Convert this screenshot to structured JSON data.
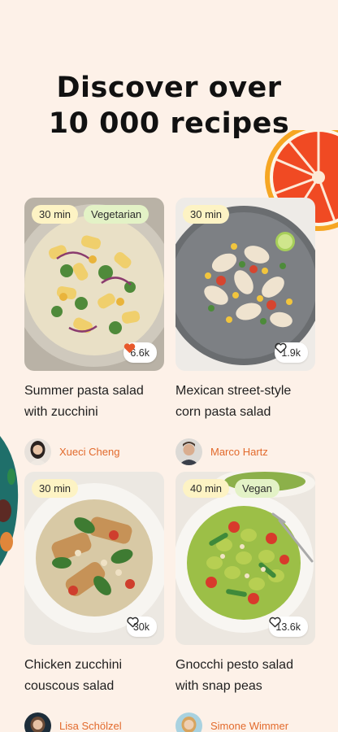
{
  "headline": {
    "line1": "Discover over",
    "line2": "10 000 recipes"
  },
  "cards": [
    {
      "time": "30 min",
      "diet": "Vegetarian",
      "likes": "6.6k",
      "liked": true,
      "title_line1": "Summer pasta salad",
      "title_line2": "with zucchini",
      "author": "Xueci Cheng"
    },
    {
      "time": "30 min",
      "diet": "",
      "likes": "1.9k",
      "liked": false,
      "title_line1": "Mexican street-style",
      "title_line2": "corn pasta salad",
      "author": "Marco Hartz"
    },
    {
      "time": "30 min",
      "diet": "",
      "likes": "30k",
      "liked": false,
      "title_line1": "Chicken zucchini",
      "title_line2": "couscous salad",
      "author": "Lisa Schölzel"
    },
    {
      "time": "40 min",
      "diet": "Vegan",
      "likes": "13.6k",
      "liked": false,
      "title_line1": "Gnocchi pesto salad",
      "title_line2": "with snap peas",
      "author": "Simone Wimmer"
    }
  ],
  "colors": {
    "background": "#fdf1e8",
    "accent": "#e26a2c",
    "liked_heart": "#e8592b"
  },
  "icons": {
    "like": "heart-icon"
  }
}
